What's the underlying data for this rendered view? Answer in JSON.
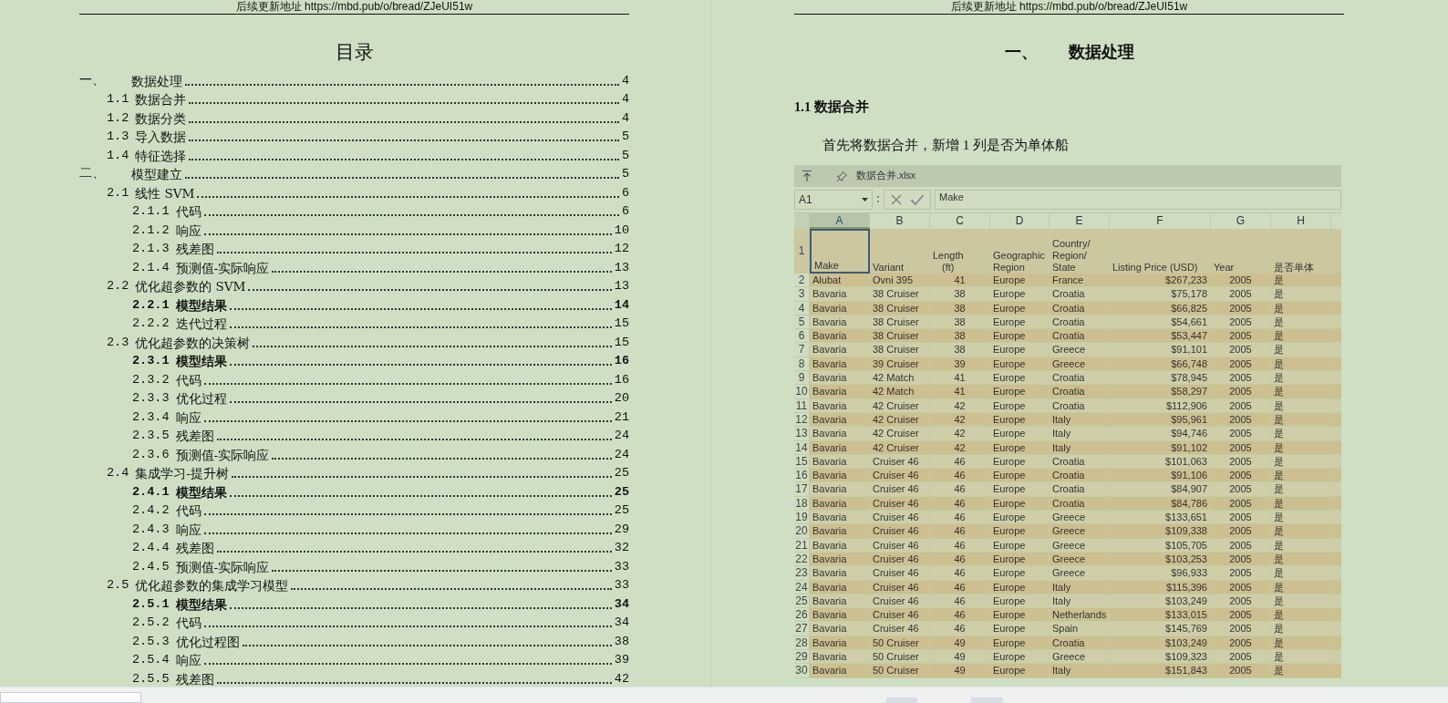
{
  "left_page": {
    "header": "后续更新地址 https://mbd.pub/o/bread/ZJeUI51w",
    "title": "目录",
    "toc": [
      {
        "number": "一、",
        "title": "数据处理",
        "page": "4",
        "bold": false,
        "children": [
          {
            "number": "1.1",
            "title": "数据合并",
            "page": "4",
            "bold": false
          },
          {
            "number": "1.2",
            "title": "数据分类",
            "page": "4",
            "bold": false
          },
          {
            "number": "1.3",
            "title": "导入数据",
            "page": "5",
            "bold": false
          },
          {
            "number": "1.4",
            "title": "特征选择",
            "page": "5",
            "bold": false
          }
        ]
      },
      {
        "number": "二、",
        "title": "模型建立",
        "page": "5",
        "bold": false,
        "children": [
          {
            "number": "2.1",
            "title": "线性 SVM",
            "page": "6",
            "bold": false,
            "children": [
              {
                "number": "2.1.1",
                "title": "代码",
                "page": "6",
                "bold": false
              },
              {
                "number": "2.1.2",
                "title": "响应",
                "page": "10",
                "bold": false
              },
              {
                "number": "2.1.3",
                "title": "残差图",
                "page": "12",
                "bold": false
              },
              {
                "number": "2.1.4",
                "title": "预测值-实际响应",
                "page": "13",
                "bold": false
              }
            ]
          },
          {
            "number": "2.2",
            "title": "优化超参数的 SVM",
            "page": "13",
            "bold": false,
            "children": [
              {
                "number": "2.2.1",
                "title": "模型结果",
                "page": "14",
                "bold": true
              },
              {
                "number": "2.2.2",
                "title": "迭代过程",
                "page": "15",
                "bold": false
              }
            ]
          },
          {
            "number": "2.3",
            "title": "优化超参数的决策树",
            "page": "15",
            "bold": false,
            "children": [
              {
                "number": "2.3.1",
                "title": "模型结果",
                "page": "16",
                "bold": true
              },
              {
                "number": "2.3.2",
                "title": "代码",
                "page": "16",
                "bold": false
              },
              {
                "number": "2.3.3",
                "title": "优化过程",
                "page": "20",
                "bold": false
              },
              {
                "number": "2.3.4",
                "title": "响应",
                "page": "21",
                "bold": false
              },
              {
                "number": "2.3.5",
                "title": "残差图",
                "page": "24",
                "bold": false
              },
              {
                "number": "2.3.6",
                "title": "预测值-实际响应",
                "page": "24",
                "bold": false
              }
            ]
          },
          {
            "number": "2.4",
            "title": "集成学习-提升树",
            "page": "25",
            "bold": false,
            "children": [
              {
                "number": "2.4.1",
                "title": "模型结果",
                "page": "25",
                "bold": true
              },
              {
                "number": "2.4.2",
                "title": "代码",
                "page": "25",
                "bold": false
              },
              {
                "number": "2.4.3",
                "title": "响应",
                "page": "29",
                "bold": false
              },
              {
                "number": "2.4.4",
                "title": "残差图",
                "page": "32",
                "bold": false
              },
              {
                "number": "2.4.5",
                "title": "预测值-实际响应",
                "page": "33",
                "bold": false
              }
            ]
          },
          {
            "number": "2.5",
            "title": "优化超参数的集成学习模型",
            "page": "33",
            "bold": false,
            "children": [
              {
                "number": "2.5.1",
                "title": "模型结果",
                "page": "34",
                "bold": true
              },
              {
                "number": "2.5.2",
                "title": "代码",
                "page": "34",
                "bold": false
              },
              {
                "number": "2.5.3",
                "title": "优化过程图",
                "page": "38",
                "bold": false
              },
              {
                "number": "2.5.4",
                "title": "响应",
                "page": "39",
                "bold": false
              },
              {
                "number": "2.5.5",
                "title": "残差图",
                "page": "42",
                "bold": false
              }
            ]
          }
        ]
      }
    ]
  },
  "right_page": {
    "header": "后续更新地址 https://mbd.pub/o/bread/ZJeUI51w",
    "heading": {
      "number": "一、",
      "title": "数据处理"
    },
    "section_title": "1.1 数据合并",
    "paragraph": "首先将数据合并，新增 1 列是否为单体船",
    "spreadsheet": {
      "file_name": "数据合并.xlsx",
      "name_box": "A1",
      "formula": "Make",
      "columns": [
        {
          "letter": "A",
          "selected": true
        },
        {
          "letter": "B",
          "selected": false
        },
        {
          "letter": "C",
          "selected": false
        },
        {
          "letter": "D",
          "selected": false
        },
        {
          "letter": "E",
          "selected": false
        },
        {
          "letter": "F",
          "selected": false
        },
        {
          "letter": "G",
          "selected": false
        },
        {
          "letter": "H",
          "selected": false
        }
      ],
      "header_row": {
        "number": "1",
        "cells": [
          "Make",
          "Variant",
          "Length\n(ft)",
          "Geographic\nRegion",
          "Country/\nRegion/\nState",
          "Listing Price (USD)",
          "Year",
          "是否单体"
        ]
      },
      "rows": [
        {
          "number": "2",
          "cells": [
            "Alubat",
            "Ovni 395",
            "41",
            "Europe",
            "France",
            "$267,233",
            "2005",
            "是"
          ]
        },
        {
          "number": "3",
          "cells": [
            "Bavaria",
            "38 Cruiser",
            "38",
            "Europe",
            "Croatia",
            "$75,178",
            "2005",
            "是"
          ]
        },
        {
          "number": "4",
          "cells": [
            "Bavaria",
            "38 Cruiser",
            "38",
            "Europe",
            "Croatia",
            "$66,825",
            "2005",
            "是"
          ]
        },
        {
          "number": "5",
          "cells": [
            "Bavaria",
            "38 Cruiser",
            "38",
            "Europe",
            "Croatia",
            "$54,661",
            "2005",
            "是"
          ]
        },
        {
          "number": "6",
          "cells": [
            "Bavaria",
            "38 Cruiser",
            "38",
            "Europe",
            "Croatia",
            "$53,447",
            "2005",
            "是"
          ]
        },
        {
          "number": "7",
          "cells": [
            "Bavaria",
            "38 Cruiser",
            "38",
            "Europe",
            "Greece",
            "$91,101",
            "2005",
            "是"
          ]
        },
        {
          "number": "8",
          "cells": [
            "Bavaria",
            "39 Cruiser",
            "39",
            "Europe",
            "Greece",
            "$66,748",
            "2005",
            "是"
          ]
        },
        {
          "number": "9",
          "cells": [
            "Bavaria",
            "42 Match",
            "41",
            "Europe",
            "Croatia",
            "$78,945",
            "2005",
            "是"
          ]
        },
        {
          "number": "10",
          "cells": [
            "Bavaria",
            "42 Match",
            "41",
            "Europe",
            "Croatia",
            "$58,297",
            "2005",
            "是"
          ]
        },
        {
          "number": "11",
          "cells": [
            "Bavaria",
            "42 Cruiser",
            "42",
            "Europe",
            "Croatia",
            "$112,906",
            "2005",
            "是"
          ]
        },
        {
          "number": "12",
          "cells": [
            "Bavaria",
            "42 Cruiser",
            "42",
            "Europe",
            "Italy",
            "$95,961",
            "2005",
            "是"
          ]
        },
        {
          "number": "13",
          "cells": [
            "Bavaria",
            "42 Cruiser",
            "42",
            "Europe",
            "Italy",
            "$94,746",
            "2005",
            "是"
          ]
        },
        {
          "number": "14",
          "cells": [
            "Bavaria",
            "42 Cruiser",
            "42",
            "Europe",
            "Italy",
            "$91,102",
            "2005",
            "是"
          ]
        },
        {
          "number": "15",
          "cells": [
            "Bavaria",
            "Cruiser 46",
            "46",
            "Europe",
            "Croatia",
            "$101,063",
            "2005",
            "是"
          ]
        },
        {
          "number": "16",
          "cells": [
            "Bavaria",
            "Cruiser 46",
            "46",
            "Europe",
            "Croatia",
            "$91,106",
            "2005",
            "是"
          ]
        },
        {
          "number": "17",
          "cells": [
            "Bavaria",
            "Cruiser 46",
            "46",
            "Europe",
            "Croatia",
            "$84,907",
            "2005",
            "是"
          ]
        },
        {
          "number": "18",
          "cells": [
            "Bavaria",
            "Cruiser 46",
            "46",
            "Europe",
            "Croatia",
            "$84,786",
            "2005",
            "是"
          ]
        },
        {
          "number": "19",
          "cells": [
            "Bavaria",
            "Cruiser 46",
            "46",
            "Europe",
            "Greece",
            "$133,651",
            "2005",
            "是"
          ]
        },
        {
          "number": "20",
          "cells": [
            "Bavaria",
            "Cruiser 46",
            "46",
            "Europe",
            "Greece",
            "$109,338",
            "2005",
            "是"
          ]
        },
        {
          "number": "21",
          "cells": [
            "Bavaria",
            "Cruiser 46",
            "46",
            "Europe",
            "Greece",
            "$105,705",
            "2005",
            "是"
          ]
        },
        {
          "number": "22",
          "cells": [
            "Bavaria",
            "Cruiser 46",
            "46",
            "Europe",
            "Greece",
            "$103,253",
            "2005",
            "是"
          ]
        },
        {
          "number": "23",
          "cells": [
            "Bavaria",
            "Cruiser 46",
            "46",
            "Europe",
            "Greece",
            "$96,933",
            "2005",
            "是"
          ]
        },
        {
          "number": "24",
          "cells": [
            "Bavaria",
            "Cruiser 46",
            "46",
            "Europe",
            "Italy",
            "$115,396",
            "2005",
            "是"
          ]
        },
        {
          "number": "25",
          "cells": [
            "Bavaria",
            "Cruiser 46",
            "46",
            "Europe",
            "Italy",
            "$103,249",
            "2005",
            "是"
          ]
        },
        {
          "number": "26",
          "cells": [
            "Bavaria",
            "Cruiser 46",
            "46",
            "Europe",
            "Netherlands",
            "$133,015",
            "2005",
            "是"
          ]
        },
        {
          "number": "27",
          "cells": [
            "Bavaria",
            "Cruiser 46",
            "46",
            "Europe",
            "Spain",
            "$145,769",
            "2005",
            "是"
          ]
        },
        {
          "number": "28",
          "cells": [
            "Bavaria",
            "50 Cruiser",
            "49",
            "Europe",
            "Croatia",
            "$103,249",
            "2005",
            "是"
          ]
        },
        {
          "number": "29",
          "cells": [
            "Bavaria",
            "50 Cruiser",
            "49",
            "Europe",
            "Greece",
            "$109,323",
            "2005",
            "是"
          ]
        },
        {
          "number": "30",
          "cells": [
            "Bavaria",
            "50 Cruiser",
            "49",
            "Europe",
            "Italy",
            "$151,843",
            "2005",
            "是"
          ]
        }
      ]
    }
  }
}
